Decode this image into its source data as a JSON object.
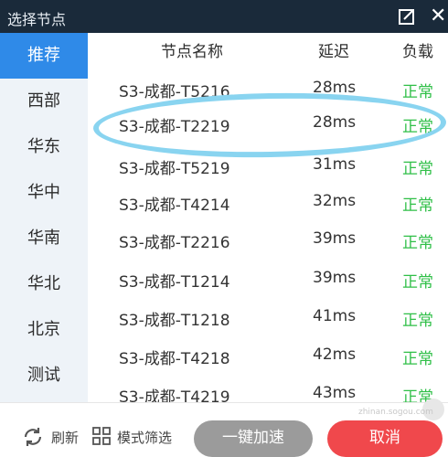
{
  "window": {
    "title": "选择节点"
  },
  "sidebar": {
    "items": [
      {
        "label": "推荐",
        "active": true
      },
      {
        "label": "西部"
      },
      {
        "label": "华东"
      },
      {
        "label": "华中"
      },
      {
        "label": "华南"
      },
      {
        "label": "华北"
      },
      {
        "label": "北京"
      },
      {
        "label": "测试"
      }
    ]
  },
  "table": {
    "headers": {
      "name": "节点名称",
      "latency": "延迟",
      "load": "负载"
    },
    "rows": [
      {
        "name": "S3-成都-T5216",
        "latency": "28ms",
        "load": "正常"
      },
      {
        "name": "S3-成都-T2219",
        "latency": "28ms",
        "load": "正常"
      },
      {
        "name": "S3-成都-T5219",
        "latency": "31ms",
        "load": "正常"
      },
      {
        "name": "S3-成都-T4214",
        "latency": "32ms",
        "load": "正常"
      },
      {
        "name": "S3-成都-T2216",
        "latency": "39ms",
        "load": "正常"
      },
      {
        "name": "S3-成都-T1214",
        "latency": "39ms",
        "load": "正常"
      },
      {
        "name": "S3-成都-T1218",
        "latency": "41ms",
        "load": "正常"
      },
      {
        "name": "S3-成都-T4218",
        "latency": "42ms",
        "load": "正常"
      },
      {
        "name": "S3-成都-T4219",
        "latency": "43ms",
        "load": "正常"
      }
    ]
  },
  "footer": {
    "refresh_label": "刷新",
    "filter_label": "模式筛选",
    "accelerate_label": "一键加速",
    "cancel_label": "取消"
  },
  "watermark": {
    "text": "zhinan.sogou.com"
  },
  "colors": {
    "titlebar": "#1a2a3a",
    "accent": "#2f8ae8",
    "status_ok": "#2fbf47",
    "cancel": "#f0484c",
    "highlight_ring": "#89d4f0"
  }
}
